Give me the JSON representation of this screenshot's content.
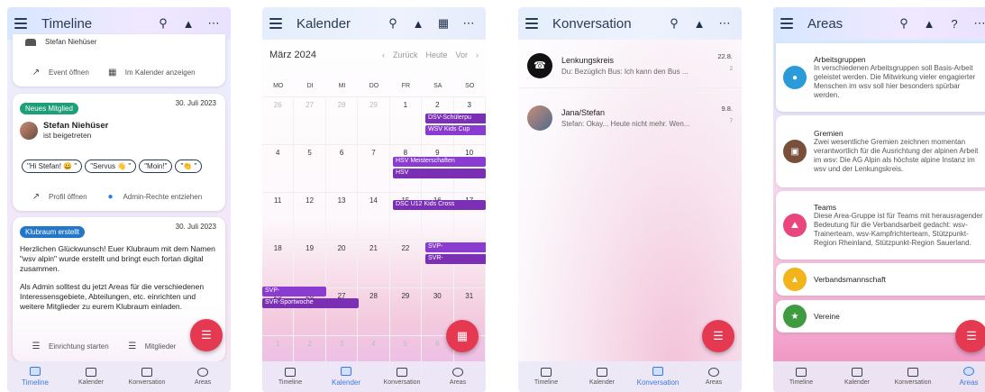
{
  "nav": {
    "items": [
      "Timeline",
      "Kalender",
      "Konversation",
      "Areas"
    ]
  },
  "timeline": {
    "title": "Timeline",
    "top": {
      "user": "Stefan Niehüser",
      "event_open": "Event öffnen",
      "in_calendar": "Im Kalender anzeigen"
    },
    "card1": {
      "badge": "Neues Mitglied",
      "date": "30. Juli 2023",
      "name": "Stefan Niehüser",
      "joined": "ist beigetreten",
      "chips": [
        "\"Hi Stefan! 😀 \"",
        "\"Servus 👋 \"",
        "\"Moin!\"",
        "\"👏 \""
      ],
      "profile": "Profil öffnen",
      "admin": "Admin-Rechte entziehen"
    },
    "card2": {
      "badge": "Klubraum erstellt",
      "date": "30. Juli 2023",
      "p1": "Herzlichen Glückwunsch! Euer Klubraum mit dem Namen \"wsv alpin\" wurde erstellt und bringt euch fortan digital zusammen.",
      "p2": "Als Admin solltest du jetzt Areas für die verschiedenen Interessensgebiete, Abteilungen, etc. einrichten und weitere Mitglieder zu eurem Klubraum einladen.",
      "setup": "Einrichtung starten",
      "members": "Mitglieder"
    }
  },
  "calendar": {
    "title": "Kalender",
    "month": "März 2024",
    "back": "Zurück",
    "today": "Heute",
    "next": "Vor",
    "weekdays": [
      "MO",
      "DI",
      "MI",
      "DO",
      "FR",
      "SA",
      "SO"
    ],
    "weeks": [
      [
        "26",
        "27",
        "28",
        "29",
        "1",
        "2",
        "3"
      ],
      [
        "4",
        "5",
        "6",
        "7",
        "8",
        "9",
        "10"
      ],
      [
        "11",
        "12",
        "13",
        "14",
        "15",
        "16",
        "17"
      ],
      [
        "18",
        "19",
        "20",
        "21",
        "22",
        "23",
        "24"
      ],
      [
        "25",
        "26",
        "27",
        "28",
        "29",
        "30",
        "31"
      ],
      [
        "1",
        "2",
        "3",
        "4",
        "5",
        "6",
        "7"
      ]
    ],
    "events": [
      "DSV-Schülerpu",
      "WSV Kids Cup",
      "HSV Meisterschaften",
      "HSV",
      "DSC U12 Kids Cross",
      "SVP-",
      "SVR-",
      "SVP-",
      "SVR-Sportwoche"
    ]
  },
  "conversation": {
    "title": "Konversation",
    "items": [
      {
        "name": "Lenkungskreis",
        "msg": "Du: Bezüglich Bus: Ich kann den Bus ...",
        "date": "22.8.",
        "count": "2"
      },
      {
        "name": "Jana/Stefan",
        "msg": "Stefan: Okay... Heute nicht mehr. Wen...",
        "date": "9.8.",
        "count": "7"
      }
    ]
  },
  "areas": {
    "title": "Areas",
    "items": [
      {
        "title": "Arbeitsgruppen",
        "desc": "In verschiedenen Arbeitsgruppen soll Basis-Arbeit geleistet werden. Die Mitwirkung vieler engagierter Menschen im wsv soll hier besonders spürbar werden.",
        "color": "#2a9bd8"
      },
      {
        "title": "Gremien",
        "desc": "Zwei wesentliche Gremien zeichnen momentan verantwortlich für die Ausrichtung der alpinen Arbeit im wsv: Die AG Alpin als höchste alpine Instanz im wsv und der Lenkungskreis.",
        "color": "#7a4f3a"
      },
      {
        "title": "Teams",
        "desc": "Diese Area-Gruppe ist für Teams mit herausragender Bedeutung für die Verbandsarbeit gedacht: wsv-Trainerteam, wsv-Kampfrichterteam, Stützpunkt-Region Rheinland, Stützpunkt-Region Sauerland.",
        "color": "#e8467c"
      },
      {
        "title": "Verbandsmannschaft",
        "desc": "",
        "color": "#f2b31b"
      },
      {
        "title": "Vereine",
        "desc": "",
        "color": "#3f9b3f"
      }
    ]
  }
}
